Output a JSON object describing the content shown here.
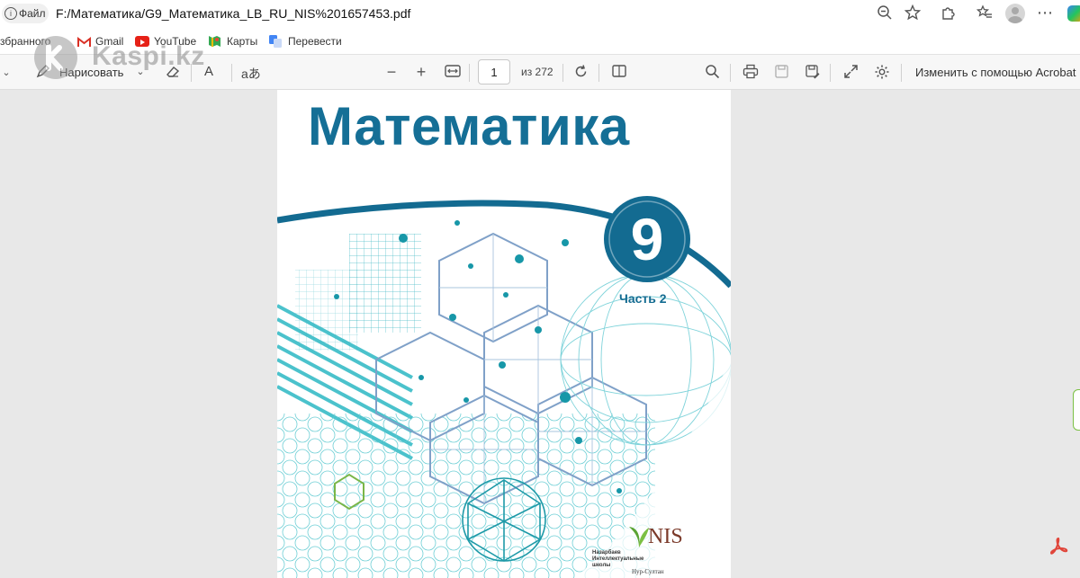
{
  "address_bar": {
    "file_chip": "Файл",
    "url": "F:/Математика/G9_Математика_LB_RU_NIS%201657453.pdf"
  },
  "bookmarks": [
    {
      "label": "збранного"
    },
    {
      "label": "Gmail"
    },
    {
      "label": "YouTube"
    },
    {
      "label": "Карты"
    },
    {
      "label": "Перевести"
    }
  ],
  "watermark": {
    "text": "Kaspi.kz"
  },
  "pdf_toolbar": {
    "draw_label": "Нарисовать",
    "text_tool": "A",
    "read_aloud": "aあ",
    "page_input": "1",
    "page_total": "из 272",
    "edit_with": "Изменить с помощью Acrobat"
  },
  "cover": {
    "title": "Математика",
    "grade": "9",
    "part": "Часть 2",
    "publisher_logo": "NIS",
    "publisher_name_lines": [
      "Назарбаев",
      "Интеллектуальные",
      "школы"
    ],
    "city": "Нур-Султан"
  },
  "colors": {
    "title_blue": "#156f96",
    "badge_blue": "#136b91",
    "teal": "#2cb8c4",
    "nis_green": "#5ba434",
    "nis_brown": "#7b3a2a"
  }
}
